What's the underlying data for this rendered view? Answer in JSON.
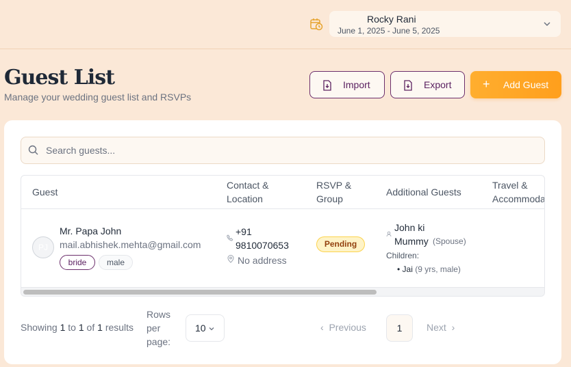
{
  "header": {
    "wedding_name": "Rocky Rani",
    "wedding_dates": "June 1, 2025 - June 5, 2025"
  },
  "page": {
    "title": "Guest List",
    "subtitle": "Manage your wedding guest list and RSVPs"
  },
  "actions": {
    "import_label": "Import",
    "export_label": "Export",
    "add_label": "Add Guest"
  },
  "search": {
    "placeholder": "Search guests..."
  },
  "table": {
    "columns": {
      "guest": "Guest",
      "contact": "Contact & Location",
      "rsvp": "RSVP & Group",
      "additional": "Additional Guests",
      "travel": "Travel & Accommodation"
    },
    "rows": [
      {
        "initials": "PJ",
        "name": "Mr. Papa John",
        "email": "mail.abhishek.mehta@gmail.com",
        "tags": [
          "bride",
          "male"
        ],
        "phone": "+91 9810070653",
        "address": "No address",
        "rsvp": "Pending",
        "additional_name": "John ki Mummy",
        "additional_relation": "(Spouse)",
        "children_label": "Children:",
        "child_name": "Jai",
        "child_detail": "(9 yrs, male)"
      }
    ]
  },
  "pagination": {
    "showing_prefix": "Showing",
    "from": "1",
    "to_word": "to",
    "to": "1",
    "of_word": "of",
    "total": "1",
    "results_word": "results",
    "rows_per_page_label": "Rows per page:",
    "rows_per_page": "10",
    "previous_label": "Previous",
    "current_page": "1",
    "next_label": "Next"
  },
  "colors": {
    "background": "#fbe8d7",
    "accent": "#ff9f1c",
    "brand_purple": "#5b2160"
  }
}
